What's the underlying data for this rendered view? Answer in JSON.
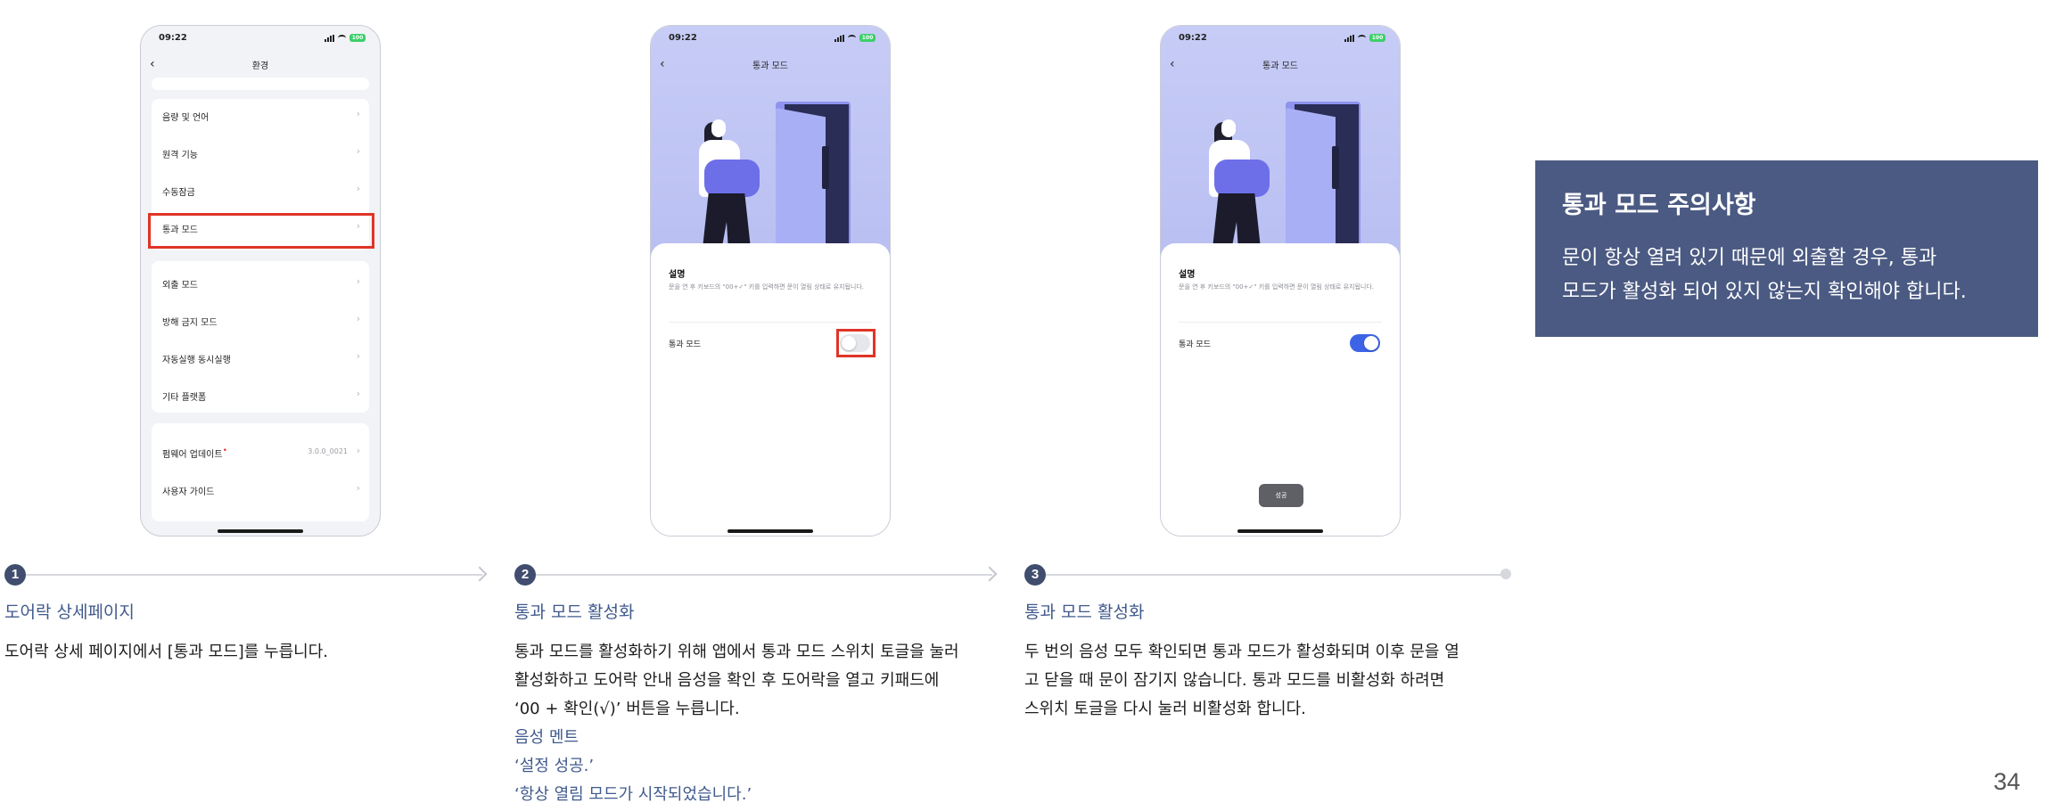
{
  "phone1": {
    "time": "09:22",
    "battery": "100",
    "title": "환경",
    "items": [
      {
        "label": "음량 및 언어"
      },
      {
        "label": "원격 기능"
      },
      {
        "label": "수동잠금"
      },
      {
        "label": "통과 모드"
      },
      {
        "label": "외출 모드"
      },
      {
        "label": "방해 금지 모드"
      },
      {
        "label": "자동실행 동시실행"
      },
      {
        "label": "기타 플랫폼"
      },
      {
        "label": "펌웨어 업데이트",
        "value": "3.0.0_0021"
      },
      {
        "label": "사용자 가이드"
      }
    ]
  },
  "phone2": {
    "time": "09:22",
    "battery": "100",
    "title": "통과 모드",
    "section_title": "설명",
    "description": "문을 연 후 키보드의 \"00+✓\" 키를 입력하면 문이 열림 상태로 유지됩니다.",
    "toggle_label": "통과 모드",
    "toggle_on": false
  },
  "phone3": {
    "time": "09:22",
    "battery": "100",
    "title": "통과 모드",
    "section_title": "설명",
    "description": "문을 연 후 키보드의 \"00+✓\" 키를 입력하면 문이 열림 상태로 유지됩니다.",
    "toggle_label": "통과 모드",
    "toggle_on": true,
    "toast": "성공"
  },
  "steps": [
    {
      "number": "1",
      "title": "도어락 상세페이지",
      "body": [
        "도어락 상세 페이지에서 [통과 모드]를 누릅니다."
      ]
    },
    {
      "number": "2",
      "title": "통과 모드 활성화",
      "body": [
        "통과 모드를 활성화하기 위해 앱에서 통과 모드 스위치 토글을 눌러",
        "활성화하고 도어락 안내 음성을 확인 후 도어락을 열고 키패드에",
        "‘00 + 확인(√)’ 버튼을 누릅니다."
      ],
      "voice_heading": "음성 멘트",
      "voice_lines": [
        "‘설정 성공.’",
        "‘항상 열림 모드가 시작되었습니다.’"
      ]
    },
    {
      "number": "3",
      "title": "통과 모드 활성화",
      "body": [
        "두 번의 음성 모두 확인되면 통과 모드가 활성화되며 이후 문을 열",
        "고 닫을 때 문이 잠기지 않습니다. 통과 모드를 비활성화 하려면",
        "스위치 토글을 다시 눌러 비활성화 합니다."
      ]
    }
  ],
  "note": {
    "title": "통과 모드 주의사항",
    "lines": [
      "문이 항상 열려 있기 때문에 외출할 경우, 통과",
      "모드가 활성화 되어 있지 않는지 확인해야 합니다."
    ]
  },
  "page_number": "34",
  "colors": {
    "accent": "#405a8c",
    "note_bg": "#4b5a82",
    "highlight": "#e03426",
    "toggle_on": "#3d64e6"
  }
}
